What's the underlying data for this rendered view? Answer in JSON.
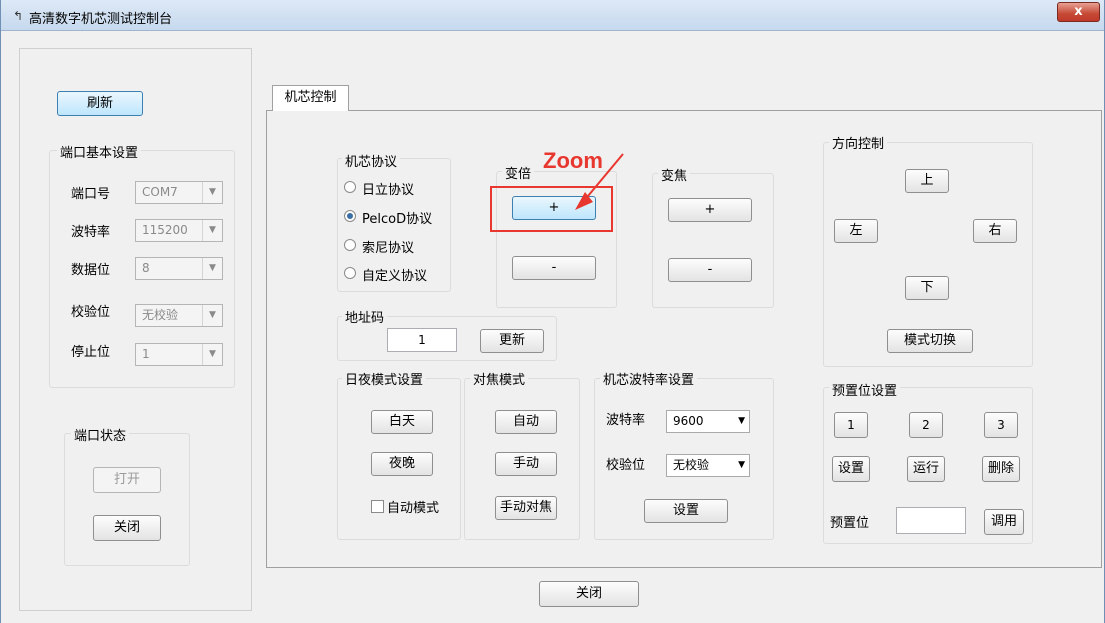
{
  "window": {
    "title": "高清数字机芯测试控制台",
    "close": "x"
  },
  "left": {
    "refresh": "刷新",
    "port_settings_title": "端口基本设置",
    "fields": [
      {
        "label": "端口号",
        "value": "COM7"
      },
      {
        "label": "波特率",
        "value": "115200"
      },
      {
        "label": "数据位",
        "value": "8"
      },
      {
        "label": "校验位",
        "value": "无校验"
      },
      {
        "label": "停止位",
        "value": "1"
      }
    ],
    "port_status_title": "端口状态",
    "open": "打开",
    "close": "关闭"
  },
  "tab": {
    "label": "机芯控制"
  },
  "protocol": {
    "title": "机芯协议",
    "options": [
      "日立协议",
      "PelcoD协议",
      "索尼协议",
      "自定义协议"
    ],
    "selected": "PelcoD协议"
  },
  "zoom": {
    "title": "变倍",
    "plus": "+",
    "minus": "-",
    "annotation": "Zoom"
  },
  "focus": {
    "title": "变焦",
    "plus": "+",
    "minus": "-"
  },
  "address": {
    "title": "地址码",
    "value": "1",
    "update": "更新"
  },
  "daynight": {
    "title": "日夜模式设置",
    "day": "白天",
    "night": "夜晚",
    "auto": "自动模式"
  },
  "focusmode": {
    "title": "对焦模式",
    "auto": "自动",
    "manual": "手动",
    "manual_focus": "手动对焦"
  },
  "baud": {
    "title": "机芯波特率设置",
    "baud_label": "波特率",
    "baud_value": "9600",
    "parity_label": "校验位",
    "parity_value": "无校验",
    "set": "设置"
  },
  "direction": {
    "title": "方向控制",
    "up": "上",
    "left": "左",
    "right": "右",
    "down": "下",
    "mode": "模式切换"
  },
  "preset": {
    "title": "预置位设置",
    "nums": [
      "1",
      "2",
      "3"
    ],
    "set": "设置",
    "run": "运行",
    "delete": "删除",
    "pos_label": "预置位",
    "pos_value": "",
    "call": "调用"
  },
  "bottom": {
    "close": "关闭"
  },
  "colors": {
    "annotation": "#e8372e"
  }
}
